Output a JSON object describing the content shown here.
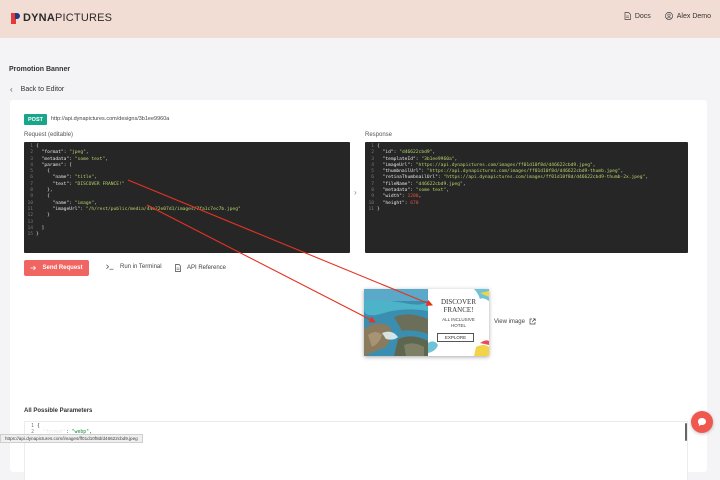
{
  "header": {
    "logo_part1": "DYNA",
    "logo_part2": "PICTURES",
    "docs_label": "Docs",
    "user_name": "Alex Demo"
  },
  "page": {
    "title": "Promotion Banner",
    "back_label": "Back to Editor"
  },
  "request": {
    "method": "POST",
    "endpoint": "http://api.dynapictures.com/designs/3b1ee9960a",
    "label": "Request (editable)",
    "lines": [
      {
        "n": "1",
        "t": "{"
      },
      {
        "n": "2",
        "t": "  \"format\": \"jpeg\","
      },
      {
        "n": "3",
        "t": "  \"metadata\": \"some text\","
      },
      {
        "n": "4",
        "t": "  \"params\": ["
      },
      {
        "n": "5",
        "t": "    {"
      },
      {
        "n": "6",
        "t": "      \"name\": \"title\","
      },
      {
        "n": "7",
        "t": "      \"text\": \"DISCOVER FRANCE!\""
      },
      {
        "n": "8",
        "t": "    },"
      },
      {
        "n": "9",
        "t": "    {"
      },
      {
        "n": "10",
        "t": "      \"name\": \"image\","
      },
      {
        "n": "11",
        "t": "      \"imageUrl\": \"/h/rest/public/media/44e22e07d1/images/7fa1c7ec7b.jpeg\""
      },
      {
        "n": "12",
        "t": "    }"
      },
      {
        "n": "13",
        "t": ""
      },
      {
        "n": "14",
        "t": "  ]"
      },
      {
        "n": "15",
        "t": "}"
      }
    ]
  },
  "response": {
    "label": "Response",
    "lines": [
      {
        "n": "1",
        "t": "{"
      },
      {
        "n": "2",
        "t": "  \"id\": \"d46622cbd9\","
      },
      {
        "n": "3",
        "t": "  \"templateId\": \"3b1ee9960a\","
      },
      {
        "n": "4",
        "t": "  \"imageUrl\": \"https://api.dynapictures.com/images/ff01d10f8d/d46622cbd9.jpeg\","
      },
      {
        "n": "5",
        "t": "  \"thumbnailUrl\": \"https://api.dynapictures.com/images/ff01d10f8d/d46622cbd9-thumb.jpeg\","
      },
      {
        "n": "6",
        "t": "  \"retinaThumbnailUrl\": \"https://api.dynapictures.com/images/ff01d10f8d/d46622cbd9-thumb-2x.jpeg\","
      },
      {
        "n": "7",
        "t": "  \"fileName\": \"d46622cbd9.jpeg\","
      },
      {
        "n": "8",
        "t": "  \"metadata\": \"some text\","
      },
      {
        "n": "9",
        "t": "  \"width\": 1200,"
      },
      {
        "n": "10",
        "t": "  \"height\": 670"
      },
      {
        "n": "11",
        "t": "}"
      }
    ]
  },
  "actions": {
    "send_label": "Send Request",
    "terminal_label": "Run in Terminal",
    "api_ref_label": "API Reference"
  },
  "preview": {
    "title_line1": "DISCOVER",
    "title_line2": "FRANCE!",
    "sub_line1": "ALL INCLUSIVE",
    "sub_line2": "HOTEL",
    "button_label": "EXPLORE",
    "view_image_label": "View image"
  },
  "params": {
    "title": "All Possible Parameters",
    "lines": [
      {
        "n": "1",
        "t": "{"
      },
      {
        "n": "2",
        "t": "  \"format\": \"webp\","
      }
    ]
  },
  "status_url": "https://api.dynapictures.com/images/ff01d10f8d/d46622cbd9.jpeg",
  "colors": {
    "header_bg": "#f1ddd3",
    "accent": "#f06461",
    "post_badge": "#1aa58b",
    "code_bg": "#262626",
    "annotation_arrow": "#e53322"
  }
}
